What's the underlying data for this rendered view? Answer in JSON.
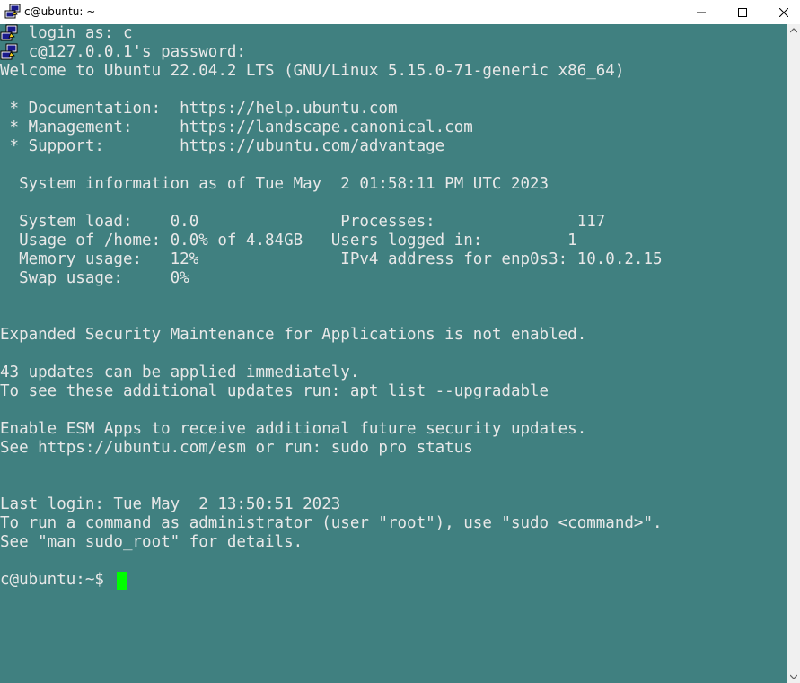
{
  "window": {
    "title": "c@ubuntu: ~",
    "icon": "putty-icon"
  },
  "colors": {
    "terminal_bg": "#408080",
    "terminal_fg": "#e8e8e8",
    "cursor": "#00ff00"
  },
  "terminal": {
    "lines": [
      "   login as: c",
      "   c@127.0.0.1's password:",
      "Welcome to Ubuntu 22.04.2 LTS (GNU/Linux 5.15.0-71-generic x86_64)",
      "",
      " * Documentation:  https://help.ubuntu.com",
      " * Management:     https://landscape.canonical.com",
      " * Support:        https://ubuntu.com/advantage",
      "",
      "  System information as of Tue May  2 01:58:11 PM UTC 2023",
      "",
      "  System load:    0.0               Processes:               117",
      "  Usage of /home: 0.0% of 4.84GB   Users logged in:         1",
      "  Memory usage:   12%               IPv4 address for enp0s3: 10.0.2.15",
      "  Swap usage:     0%",
      "",
      "",
      "Expanded Security Maintenance for Applications is not enabled.",
      "",
      "43 updates can be applied immediately.",
      "To see these additional updates run: apt list --upgradable",
      "",
      "Enable ESM Apps to receive additional future security updates.",
      "See https://ubuntu.com/esm or run: sudo pro status",
      "",
      "",
      "Last login: Tue May  2 13:50:51 2023",
      "To run a command as administrator (user \"root\"), use \"sudo <command>\".",
      "See \"man sudo_root\" for details.",
      "",
      "c@ubuntu:~$ "
    ]
  }
}
